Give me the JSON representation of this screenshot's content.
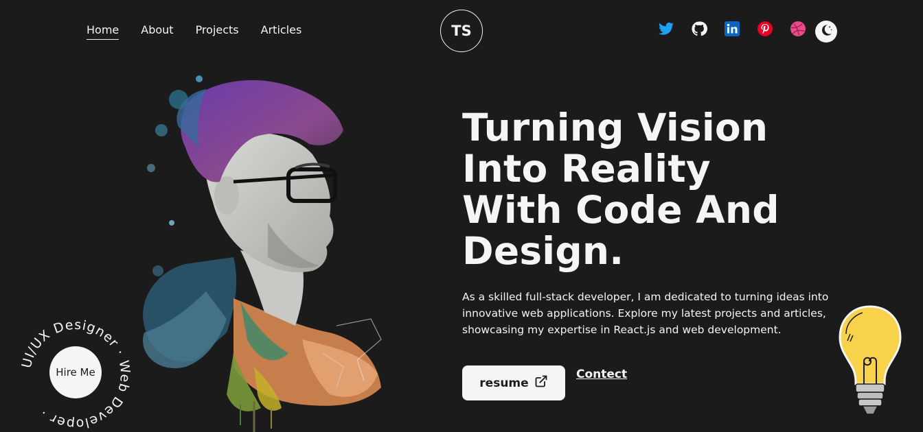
{
  "nav": {
    "links": [
      {
        "label": "Home",
        "active": true
      },
      {
        "label": "About",
        "active": false
      },
      {
        "label": "Projects",
        "active": false
      },
      {
        "label": "Articles",
        "active": false
      }
    ],
    "logo": "TS"
  },
  "socials": [
    {
      "icon": "twitter-icon",
      "color": "#1DA1F2"
    },
    {
      "icon": "github-icon",
      "color": "#f5f5f5"
    },
    {
      "icon": "linkedin-icon",
      "color": "#0A66C2"
    },
    {
      "icon": "pinterest-icon",
      "color": "#E60023"
    },
    {
      "icon": "dribbble-icon",
      "color": "#EA4C89"
    }
  ],
  "theme_toggle": {
    "icon": "moon-icon"
  },
  "hero": {
    "headline_lines": [
      "Turning Vision",
      "Into Reality",
      "With Code And",
      "Design."
    ],
    "intro": "As a skilled full-stack developer, I am dedicated to turning ideas into innovative web applications. Explore my latest projects and articles, showcasing my expertise in React.js and web development.",
    "resume_label": "resume",
    "contact_label": "Contect"
  },
  "badge": {
    "ring_text": "UI/UX Designer · Web Developer · ",
    "button_label": "Hire Me"
  },
  "colors": {
    "background": "#1b1b1b",
    "text": "#f5f5f5"
  }
}
